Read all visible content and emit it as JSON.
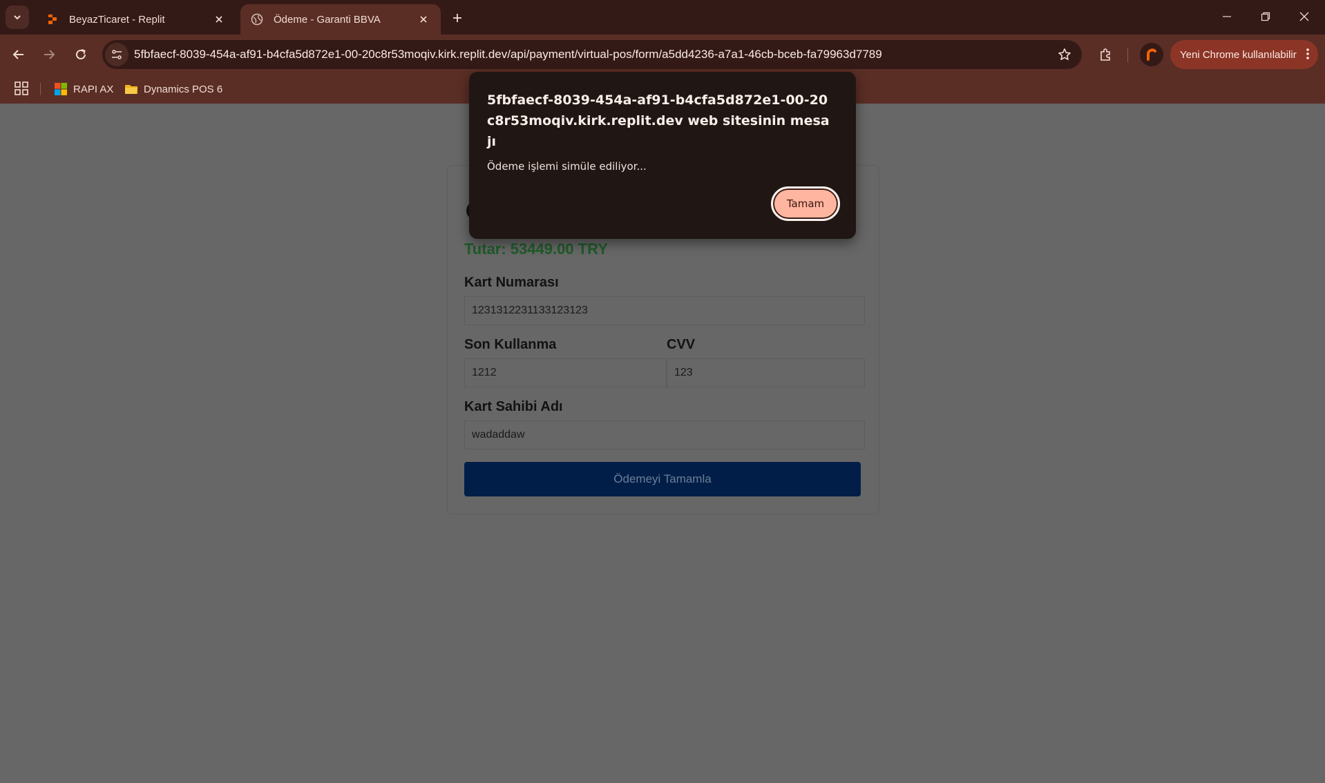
{
  "browser": {
    "tabs": [
      {
        "title": "BeyazTicaret - Replit",
        "active": false
      },
      {
        "title": "Ödeme - Garanti BBVA",
        "active": true
      }
    ],
    "url": "5fbfaecf-8039-454a-af91-b4cfa5d872e1-00-20c8r53moqiv.kirk.replit.dev/api/payment/virtual-pos/form/a5dd4236-a7a1-46cb-bceb-fa79963d7789",
    "update_label": "Yeni Chrome kullanılabilir",
    "bookmarks": [
      {
        "label": "RAPI AX",
        "icon": "windows-logo-icon"
      },
      {
        "label": "Dynamics POS 6",
        "icon": "folder-icon"
      }
    ],
    "colors": {
      "frame": "#341a16",
      "toolbar": "#5a2e25",
      "update_button": "#8c3527"
    }
  },
  "payment_form": {
    "amount": "Tutar: 53449.00 TRY",
    "card_number_label": "Kart Numarası",
    "card_number_value": "1231312231133123123",
    "expiry_label": "Son Kullanma",
    "expiry_value": "1212",
    "cvv_label": "CVV",
    "cvv_value": "123",
    "holder_label": "Kart Sahibi Adı",
    "holder_value": "wadaddaw",
    "submit_label": "Ödemeyi Tamamla",
    "colors": {
      "amount": "#1e5b28",
      "submit": "#001e48"
    }
  },
  "alert_dialog": {
    "title": "5fbfaecf-8039-454a-af91-b4cfa5d872e1-00-20c8r53moqiv.kirk.replit.dev web sitesinin mesajı",
    "message": "Ödeme işlemi simüle ediliyor...",
    "ok_label": "Tamam"
  }
}
